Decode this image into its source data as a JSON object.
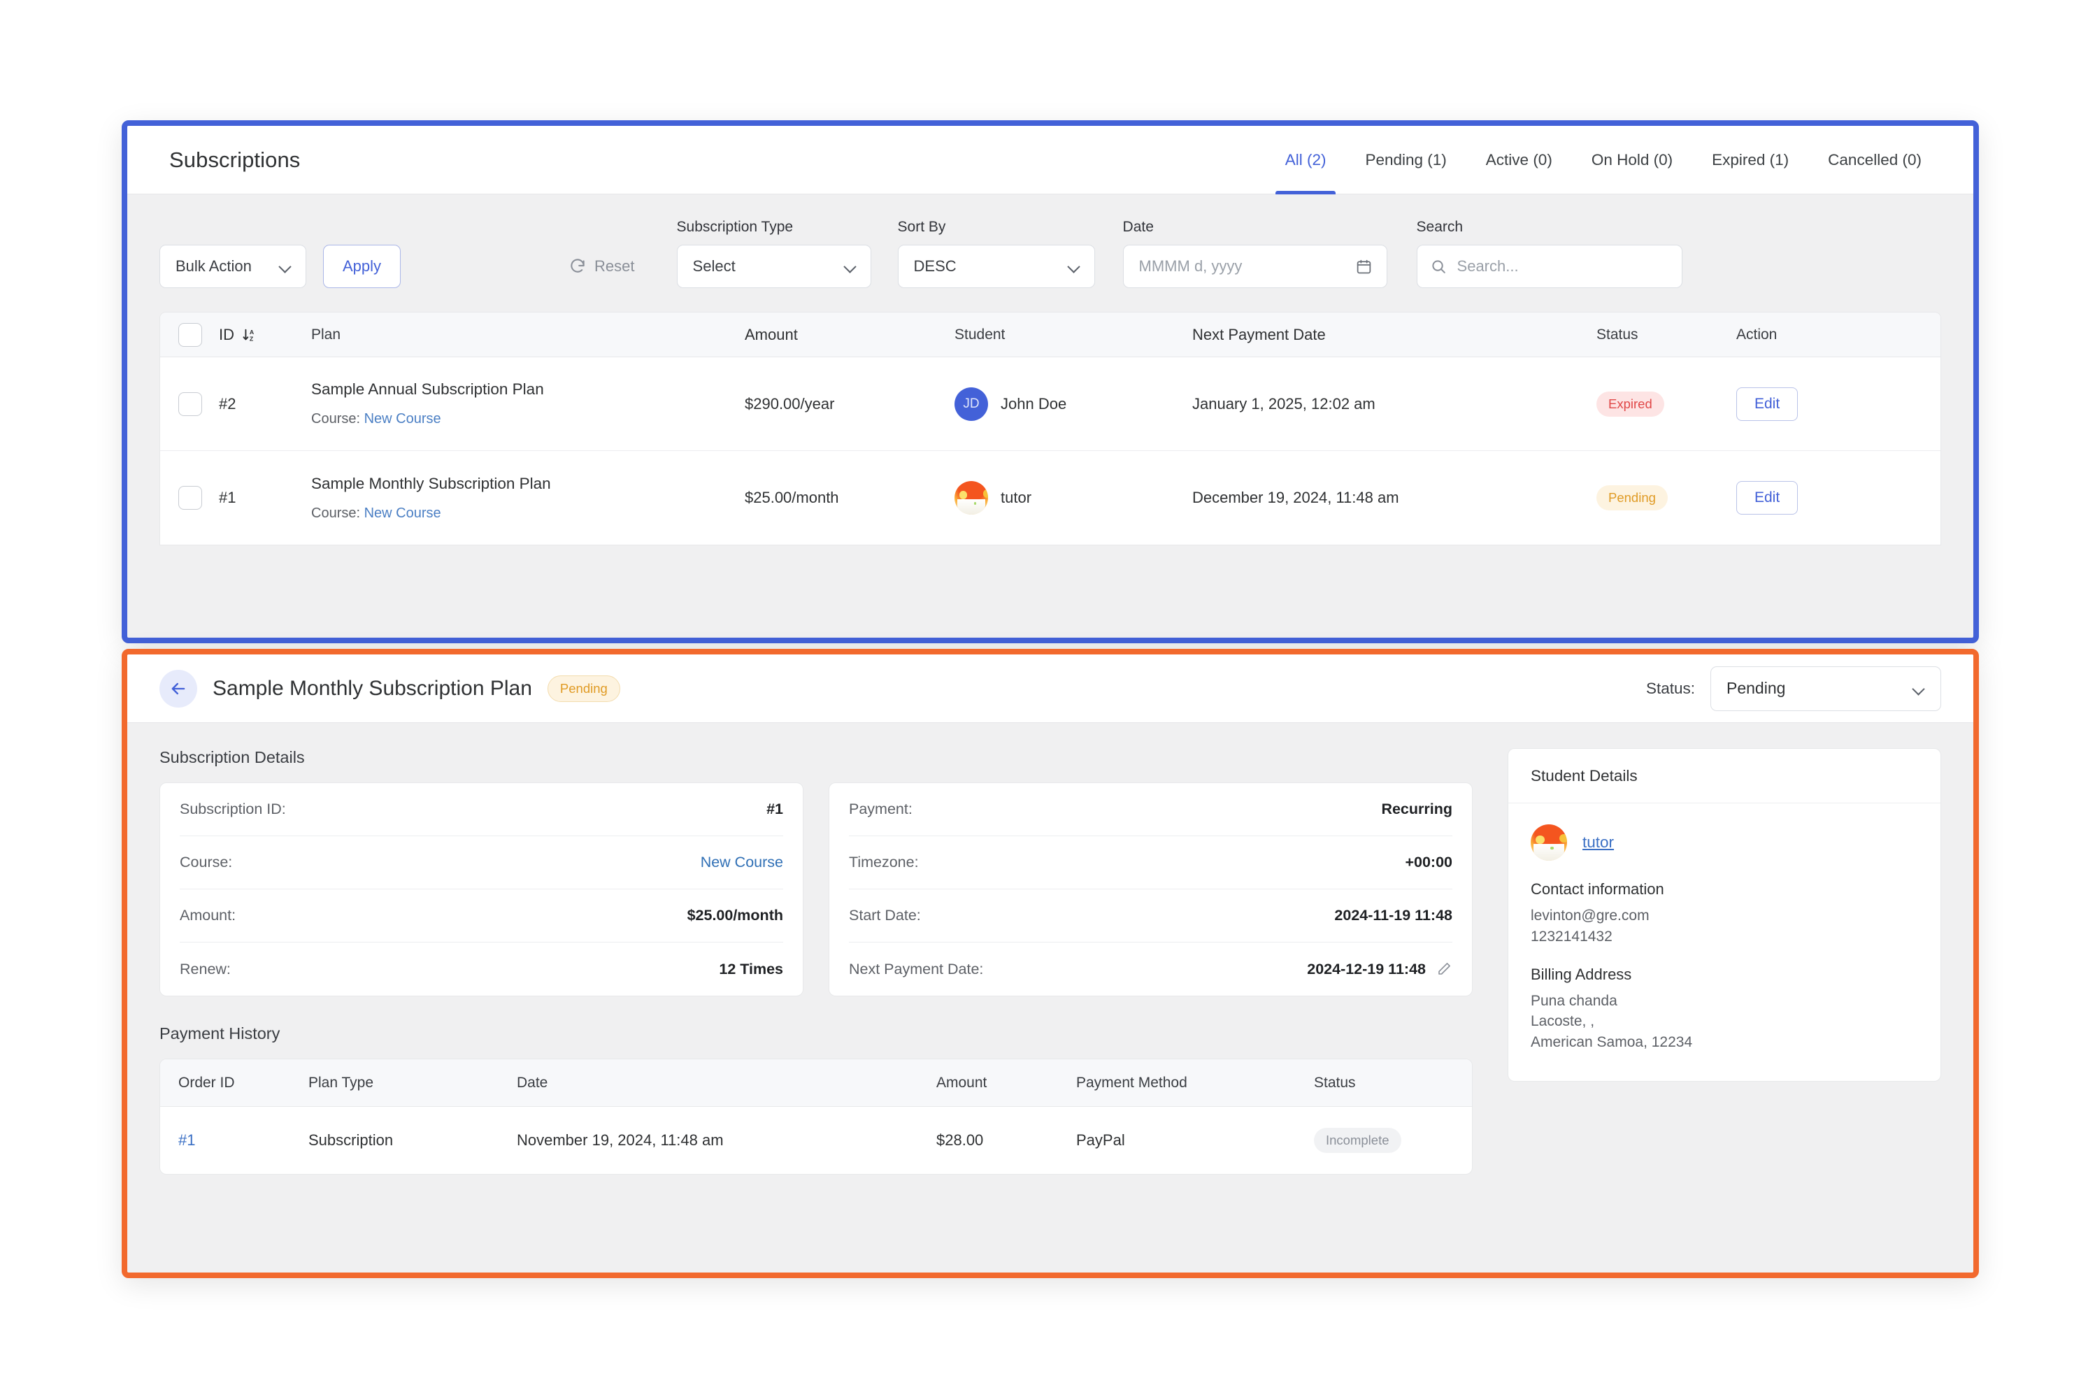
{
  "top_panel": {
    "title": "Subscriptions",
    "tabs": [
      {
        "label": "All (2)",
        "active": true
      },
      {
        "label": "Pending (1)",
        "active": false
      },
      {
        "label": "Active (0)",
        "active": false
      },
      {
        "label": "On Hold (0)",
        "active": false
      },
      {
        "label": "Expired (1)",
        "active": false
      },
      {
        "label": "Cancelled (0)",
        "active": false
      }
    ],
    "toolbar": {
      "bulk_action_value": "Bulk Action",
      "apply_label": "Apply",
      "reset_label": "Reset",
      "reset_icon": "refresh-icon",
      "subscription_type_label": "Subscription Type",
      "subscription_type_value": "Select",
      "sort_by_label": "Sort By",
      "sort_by_value": "DESC",
      "date_label": "Date",
      "date_placeholder": "MMMM d, yyyy",
      "date_icon": "calendar-icon",
      "search_label": "Search",
      "search_placeholder": "Search...",
      "search_icon": "search-icon"
    },
    "table": {
      "columns": [
        "ID",
        "Plan",
        "Amount",
        "Student",
        "Next Payment Date",
        "Status",
        "Action"
      ],
      "sort_icon": "sort-descending-az-icon",
      "rows": [
        {
          "id": "#2",
          "plan": "Sample Annual Subscription Plan",
          "course_label": "Course:",
          "course_link": "New Course",
          "amount": "$290.00/year",
          "student": "John Doe",
          "student_initials": "JD",
          "student_avatar": "initials-avatar",
          "next_payment_date": "January 1, 2025, 12:02 am",
          "status": "Expired",
          "status_kind": "expired",
          "action_label": "Edit"
        },
        {
          "id": "#1",
          "plan": "Sample Monthly Subscription Plan",
          "course_label": "Course:",
          "course_link": "New Course",
          "amount": "$25.00/month",
          "student": "tutor",
          "student_initials": "",
          "student_avatar": "photo-avatar",
          "next_payment_date": "December 19, 2024, 11:48 am",
          "status": "Pending",
          "status_kind": "pending",
          "action_label": "Edit"
        }
      ]
    }
  },
  "detail_panel": {
    "back_icon": "arrow-left-icon",
    "title": "Sample Monthly Subscription Plan",
    "title_badge": "Pending",
    "status_label": "Status:",
    "status_value": "Pending",
    "subscription_details_title": "Subscription Details",
    "left_card": [
      {
        "key": "Subscription ID:",
        "value": "#1",
        "kind": "strong"
      },
      {
        "key": "Course:",
        "value": "New Course",
        "kind": "link"
      },
      {
        "key": "Amount:",
        "value": "$25.00/month",
        "kind": "strong"
      },
      {
        "key": "Renew:",
        "value": "12 Times",
        "kind": "strong"
      }
    ],
    "right_card": [
      {
        "key": "Payment:",
        "value": "Recurring",
        "kind": "strong"
      },
      {
        "key": "Timezone:",
        "value": "+00:00",
        "kind": "strong"
      },
      {
        "key": "Start Date:",
        "value": "2024-11-19 11:48",
        "kind": "strong"
      },
      {
        "key": "Next Payment Date:",
        "value": "2024-12-19 11:48",
        "kind": "strong-edit",
        "edit_icon": "pencil-icon"
      }
    ],
    "payment_history_title": "Payment History",
    "payment_history": {
      "columns": [
        "Order ID",
        "Plan Type",
        "Date",
        "Amount",
        "Payment Method",
        "Status"
      ],
      "rows": [
        {
          "order_id": "#1",
          "plan_type": "Subscription",
          "date": "November 19, 2024, 11:48 am",
          "amount": "$28.00",
          "payment_method": "PayPal",
          "status": "Incomplete"
        }
      ]
    },
    "student_details": {
      "title": "Student Details",
      "name": "tutor",
      "avatar": "photo-avatar",
      "contact_heading": "Contact information",
      "email": "levinton@gre.com",
      "phone": "1232141432",
      "billing_heading": "Billing Address",
      "address_line1": "Puna chanda",
      "address_line2": "Lacoste, ,",
      "address_line3": "American Samoa, 12234"
    }
  },
  "colors": {
    "top_border": "#4361d8",
    "bottom_border": "#f2692d",
    "accent": "#4361d8",
    "link": "#3a6fc4",
    "expired": "#e04747",
    "pending": "#e09b25"
  }
}
